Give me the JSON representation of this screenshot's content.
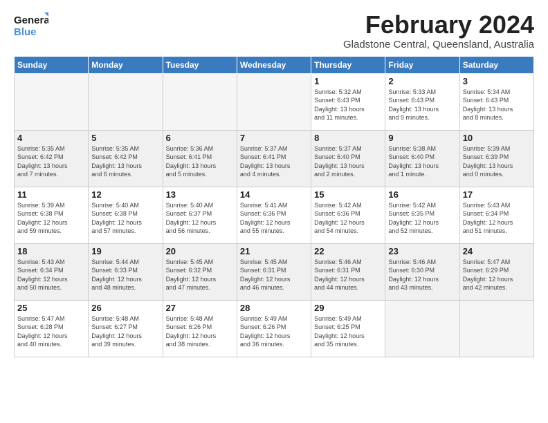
{
  "logo": {
    "line1": "General",
    "line2": "Blue"
  },
  "title": "February 2024",
  "subtitle": "Gladstone Central, Queensland, Australia",
  "days_of_week": [
    "Sunday",
    "Monday",
    "Tuesday",
    "Wednesday",
    "Thursday",
    "Friday",
    "Saturday"
  ],
  "weeks": [
    [
      {
        "day": "",
        "info": ""
      },
      {
        "day": "",
        "info": ""
      },
      {
        "day": "",
        "info": ""
      },
      {
        "day": "",
        "info": ""
      },
      {
        "day": "1",
        "info": "Sunrise: 5:32 AM\nSunset: 6:43 PM\nDaylight: 13 hours\nand 11 minutes."
      },
      {
        "day": "2",
        "info": "Sunrise: 5:33 AM\nSunset: 6:43 PM\nDaylight: 13 hours\nand 9 minutes."
      },
      {
        "day": "3",
        "info": "Sunrise: 5:34 AM\nSunset: 6:43 PM\nDaylight: 13 hours\nand 8 minutes."
      }
    ],
    [
      {
        "day": "4",
        "info": "Sunrise: 5:35 AM\nSunset: 6:42 PM\nDaylight: 13 hours\nand 7 minutes."
      },
      {
        "day": "5",
        "info": "Sunrise: 5:35 AM\nSunset: 6:42 PM\nDaylight: 13 hours\nand 6 minutes."
      },
      {
        "day": "6",
        "info": "Sunrise: 5:36 AM\nSunset: 6:41 PM\nDaylight: 13 hours\nand 5 minutes."
      },
      {
        "day": "7",
        "info": "Sunrise: 5:37 AM\nSunset: 6:41 PM\nDaylight: 13 hours\nand 4 minutes."
      },
      {
        "day": "8",
        "info": "Sunrise: 5:37 AM\nSunset: 6:40 PM\nDaylight: 13 hours\nand 2 minutes."
      },
      {
        "day": "9",
        "info": "Sunrise: 5:38 AM\nSunset: 6:40 PM\nDaylight: 13 hours\nand 1 minute."
      },
      {
        "day": "10",
        "info": "Sunrise: 5:39 AM\nSunset: 6:39 PM\nDaylight: 13 hours\nand 0 minutes."
      }
    ],
    [
      {
        "day": "11",
        "info": "Sunrise: 5:39 AM\nSunset: 6:38 PM\nDaylight: 12 hours\nand 59 minutes."
      },
      {
        "day": "12",
        "info": "Sunrise: 5:40 AM\nSunset: 6:38 PM\nDaylight: 12 hours\nand 57 minutes."
      },
      {
        "day": "13",
        "info": "Sunrise: 5:40 AM\nSunset: 6:37 PM\nDaylight: 12 hours\nand 56 minutes."
      },
      {
        "day": "14",
        "info": "Sunrise: 5:41 AM\nSunset: 6:36 PM\nDaylight: 12 hours\nand 55 minutes."
      },
      {
        "day": "15",
        "info": "Sunrise: 5:42 AM\nSunset: 6:36 PM\nDaylight: 12 hours\nand 54 minutes."
      },
      {
        "day": "16",
        "info": "Sunrise: 5:42 AM\nSunset: 6:35 PM\nDaylight: 12 hours\nand 52 minutes."
      },
      {
        "day": "17",
        "info": "Sunrise: 5:43 AM\nSunset: 6:34 PM\nDaylight: 12 hours\nand 51 minutes."
      }
    ],
    [
      {
        "day": "18",
        "info": "Sunrise: 5:43 AM\nSunset: 6:34 PM\nDaylight: 12 hours\nand 50 minutes."
      },
      {
        "day": "19",
        "info": "Sunrise: 5:44 AM\nSunset: 6:33 PM\nDaylight: 12 hours\nand 48 minutes."
      },
      {
        "day": "20",
        "info": "Sunrise: 5:45 AM\nSunset: 6:32 PM\nDaylight: 12 hours\nand 47 minutes."
      },
      {
        "day": "21",
        "info": "Sunrise: 5:45 AM\nSunset: 6:31 PM\nDaylight: 12 hours\nand 46 minutes."
      },
      {
        "day": "22",
        "info": "Sunrise: 5:46 AM\nSunset: 6:31 PM\nDaylight: 12 hours\nand 44 minutes."
      },
      {
        "day": "23",
        "info": "Sunrise: 5:46 AM\nSunset: 6:30 PM\nDaylight: 12 hours\nand 43 minutes."
      },
      {
        "day": "24",
        "info": "Sunrise: 5:47 AM\nSunset: 6:29 PM\nDaylight: 12 hours\nand 42 minutes."
      }
    ],
    [
      {
        "day": "25",
        "info": "Sunrise: 5:47 AM\nSunset: 6:28 PM\nDaylight: 12 hours\nand 40 minutes."
      },
      {
        "day": "26",
        "info": "Sunrise: 5:48 AM\nSunset: 6:27 PM\nDaylight: 12 hours\nand 39 minutes."
      },
      {
        "day": "27",
        "info": "Sunrise: 5:48 AM\nSunset: 6:26 PM\nDaylight: 12 hours\nand 38 minutes."
      },
      {
        "day": "28",
        "info": "Sunrise: 5:49 AM\nSunset: 6:26 PM\nDaylight: 12 hours\nand 36 minutes."
      },
      {
        "day": "29",
        "info": "Sunrise: 5:49 AM\nSunset: 6:25 PM\nDaylight: 12 hours\nand 35 minutes."
      },
      {
        "day": "",
        "info": ""
      },
      {
        "day": "",
        "info": ""
      }
    ]
  ]
}
